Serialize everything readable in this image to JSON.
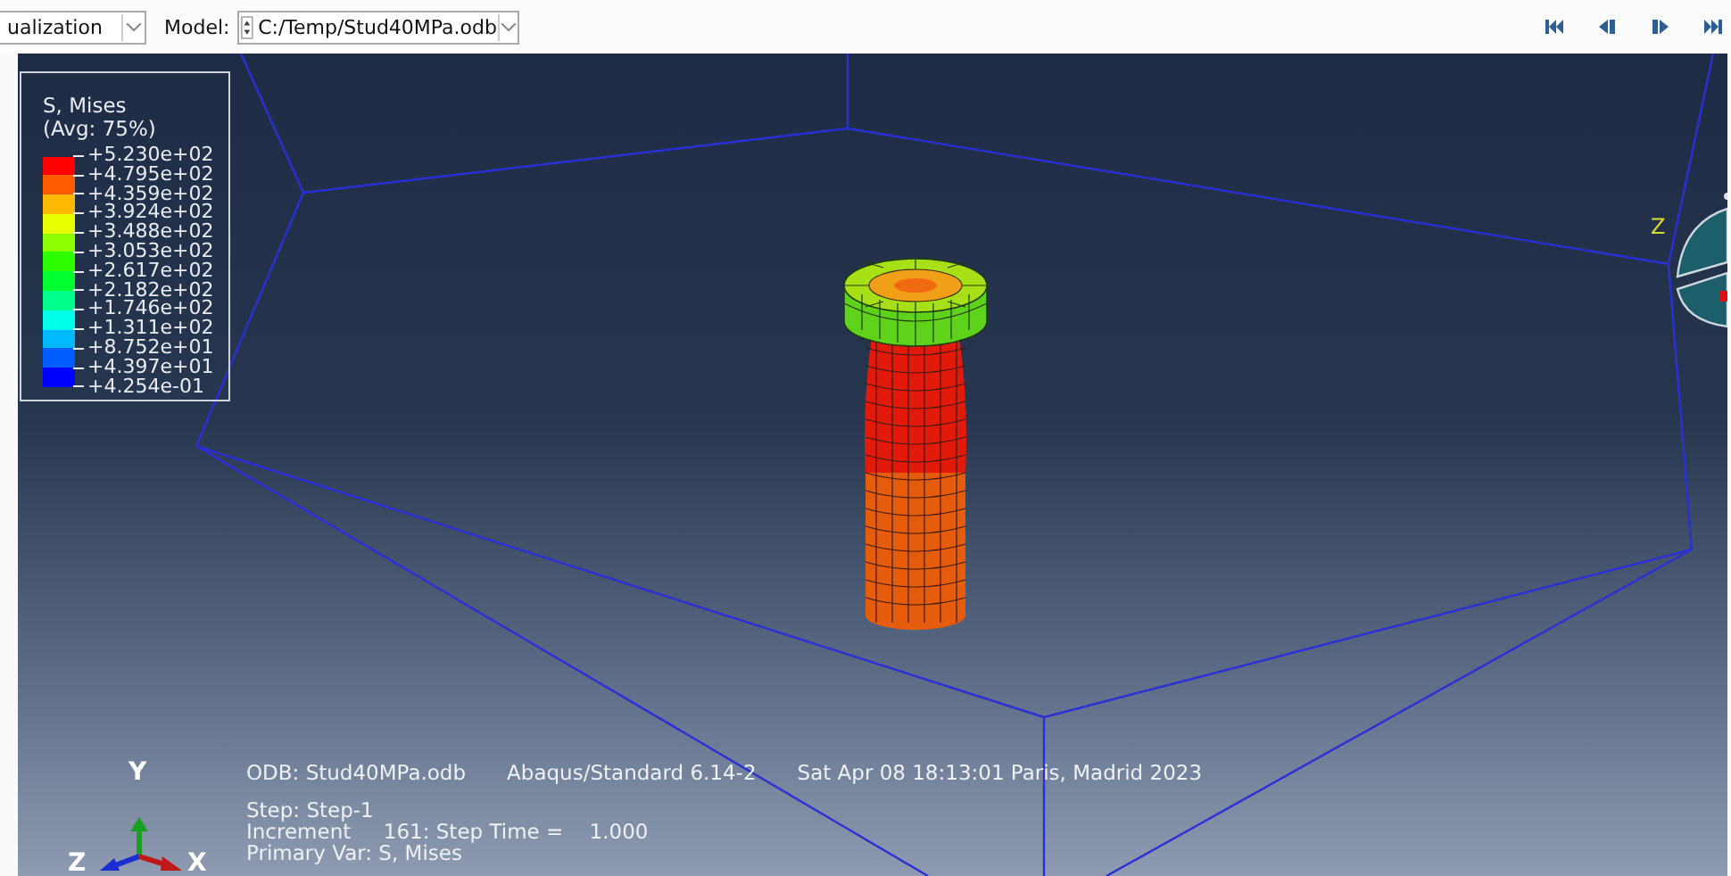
{
  "toolbar": {
    "module_combo": {
      "value": "ualization"
    },
    "model_label": "Model:",
    "model_combo": {
      "value": "C:/Temp/Stud40MPa.odb"
    },
    "playback_buttons": [
      {
        "kind": "first"
      },
      {
        "kind": "previous"
      },
      {
        "kind": "next"
      },
      {
        "kind": "last"
      }
    ]
  },
  "legend": {
    "title": "S, Mises",
    "subtitle": "(Avg: 75%)",
    "bands": [
      {
        "color": "#ff0000"
      },
      {
        "color": "#ff5d00"
      },
      {
        "color": "#ffb900"
      },
      {
        "color": "#e8ff00"
      },
      {
        "color": "#8bff00"
      },
      {
        "color": "#2eff00"
      },
      {
        "color": "#00ff2e"
      },
      {
        "color": "#00ff8b"
      },
      {
        "color": "#00ffe8"
      },
      {
        "color": "#00b9ff"
      },
      {
        "color": "#005dff"
      },
      {
        "color": "#0000ff"
      }
    ],
    "labels": [
      "+5.230e+02",
      "+4.795e+02",
      "+4.359e+02",
      "+3.924e+02",
      "+3.488e+02",
      "+3.053e+02",
      "+2.617e+02",
      "+2.182e+02",
      "+1.746e+02",
      "+1.311e+02",
      "+8.752e+01",
      "+4.397e+01",
      "+4.254e-01"
    ]
  },
  "info": {
    "odb": "ODB: Stud40MPa.odb",
    "solver": "Abaqus/Standard 6.14-2",
    "date": "Sat Apr 08 18:13:01 Paris, Madrid 2023",
    "step": "Step: Step-1",
    "increment": "Increment     161: Step Time =    1.000",
    "primary_var": "Primary Var: S, Mises"
  },
  "triad": {
    "axes": [
      {
        "label": "Y"
      },
      {
        "label": "Z"
      },
      {
        "label": "X"
      }
    ]
  },
  "view_triad": {
    "label": "Z"
  }
}
